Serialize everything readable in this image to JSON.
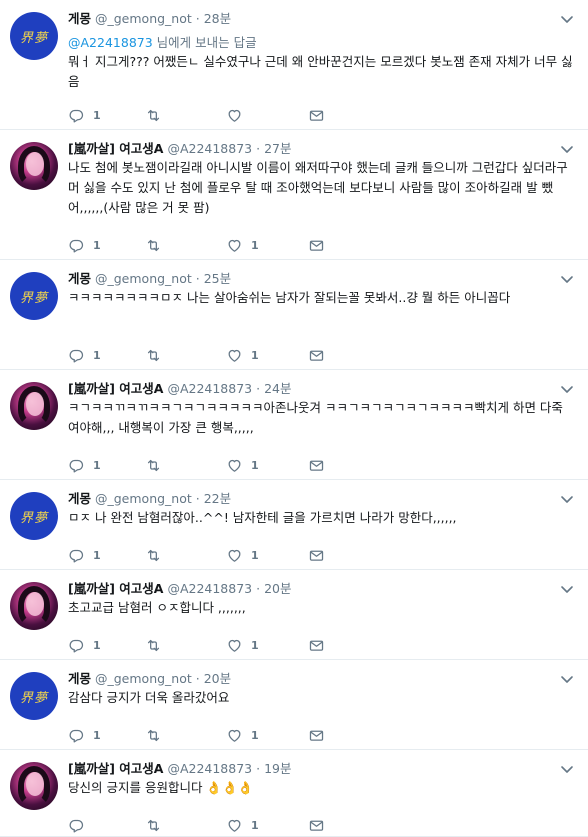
{
  "tweets": [
    {
      "name": "게몽",
      "handle": "@_gemong_not",
      "time": "28분",
      "reply_to_mention": "@A22418873",
      "reply_to_suffix": " 님에게 보내는 답글",
      "text": "뭐ㅓ 지그게??? 어쨌든ㄴ 실수였구나 근데 왜 안바꾼건지는 모르겠다 봇노잼 존재 자체가 너무 싫음",
      "avatar": "blue-kanji",
      "avatar_text": "界夢",
      "replies": "1",
      "retweets": "",
      "likes": ""
    },
    {
      "name": "[嵐까살] 여고생A",
      "handle": "@A22418873",
      "time": "27분",
      "text": "나도 첨에 봇노잼이라길래 아니시발 이름이 왜저따구야 했는데 글캐 들으니까 그런갑다 싶더라구 머 싫을 수도 있지 난 첨에 플로우 탈 때 조아했억는데 보다보니 사람들 많이 조아하길래 발 뺐어,,,,,,(사람 많은 거 못 팜)",
      "avatar": "photo",
      "replies": "1",
      "retweets": "",
      "likes": "1"
    },
    {
      "name": "게몽",
      "handle": "@_gemong_not",
      "time": "25분",
      "text": "ㅋㅋㅋㅋㅋㅋㅋㅋㅁㅈ 나는 살아숨쉬는 남자가 잘되는꼴 못봐서..걍 뭘 하든 아니꼽다",
      "avatar": "blue-kanji",
      "avatar_text": "界夢",
      "replies": "1",
      "retweets": "",
      "likes": "1"
    },
    {
      "name": "[嵐까살] 여고생A",
      "handle": "@A22418873",
      "time": "24분",
      "text": "ㅋㄱㅋㅋㄲㅋㄲㅋㅋㄱㅋㄱㅋㅋㅋㅋㅋ아존나웃겨 ㅋㅋㄱㅋㄱㅋㄱㅋㄱㅋㅋㅋㅋ빡치게 하면 다죽여야해,,, 내행복이 가장 큰 행복,,,,,",
      "avatar": "photo",
      "replies": "1",
      "retweets": "",
      "likes": "1"
    },
    {
      "name": "게몽",
      "handle": "@_gemong_not",
      "time": "22분",
      "text": "ㅁㅈ 나 완전 남혐러잖아..^^! 남자한테 글을 가르치면 나라가 망한다,,,,,,",
      "avatar": "blue-kanji",
      "avatar_text": "界夢",
      "replies": "1",
      "retweets": "",
      "likes": "1"
    },
    {
      "name": "[嵐까살] 여고생A",
      "handle": "@A22418873",
      "time": "20분",
      "text": "초고교급 남혐러 ㅇㅈ합니다 ,,,,,,,",
      "avatar": "photo",
      "replies": "1",
      "retweets": "",
      "likes": "1"
    },
    {
      "name": "게몽",
      "handle": "@_gemong_not",
      "time": "20분",
      "text": "감삼다 긍지가 더욱 올라갔어요",
      "avatar": "blue-kanji",
      "avatar_text": "界夢",
      "replies": "1",
      "retweets": "",
      "likes": "1"
    },
    {
      "name": "[嵐까살] 여고생A",
      "handle": "@A22418873",
      "time": "19분",
      "text": "당신의 긍지를 응원합니다 👌👌👌",
      "avatar": "photo",
      "replies": "",
      "retweets": "",
      "likes": "1"
    }
  ],
  "separator": "·",
  "icons": {
    "reply": "reply-icon",
    "retweet": "retweet-icon",
    "like": "heart-icon",
    "dm": "envelope-icon",
    "caret": "chevron-down-icon"
  },
  "colors": {
    "secondary_text": "#657786",
    "mention": "#1b95e0",
    "divider": "#e6ecf0"
  }
}
